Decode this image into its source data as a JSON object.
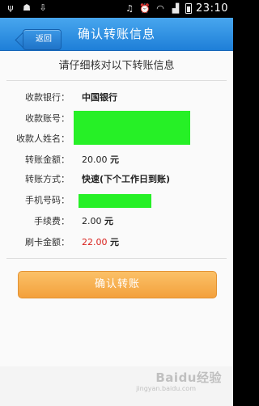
{
  "status_bar": {
    "time": "23:10"
  },
  "header": {
    "back_label": "返回",
    "title": "确认转账信息"
  },
  "main": {
    "subtitle": "请仔细核对以下转账信息",
    "rows": [
      {
        "label": "收款银行：",
        "value": "中国银行"
      },
      {
        "label": "收款账号：",
        "value": ""
      },
      {
        "label": "收款人姓名：",
        "value": ""
      },
      {
        "label": "转账金额：",
        "value": "20.00",
        "unit": "元"
      },
      {
        "label": "转账方式：",
        "value": "快速(下个工作日到账)"
      },
      {
        "label": "手机号码：",
        "value": ""
      },
      {
        "label": "手续费：",
        "value": "2.00",
        "unit": "元"
      },
      {
        "label": "刷卡金额：",
        "value": "22.00",
        "unit": "元"
      }
    ],
    "confirm_label": "确认转账"
  },
  "colors": {
    "header": "#2b8fe3",
    "confirm_button": "#f6ad4b",
    "amount_highlight": "#d9201c",
    "redaction": "#26f026"
  },
  "watermark": {
    "brand": "Baidu经验",
    "sub": "jingyan.baidu.com"
  }
}
